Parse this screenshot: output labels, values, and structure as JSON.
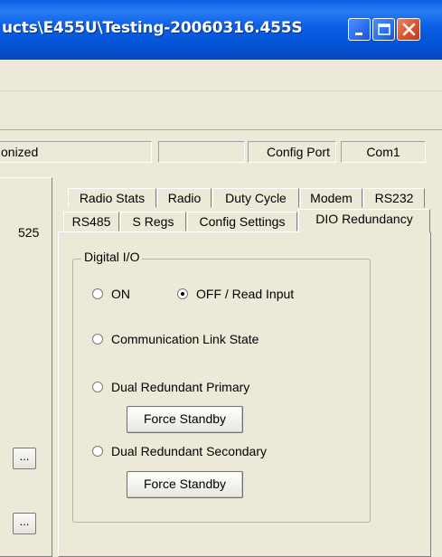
{
  "window": {
    "title": "ucts\\E455U\\Testing-20060316.455S"
  },
  "status_bar": {
    "fields": [
      "onized",
      "",
      "Config Port",
      "Com1"
    ]
  },
  "left_panel": {
    "text": "525",
    "buttons": [
      "...",
      "..."
    ]
  },
  "tabs": {
    "row1": [
      "Radio Stats",
      "Radio",
      "Duty Cycle",
      "Modem",
      "RS232"
    ],
    "row2": [
      "RS485",
      "S Regs",
      "Config Settings",
      "DIO Redundancy"
    ],
    "active": "DIO Redundancy"
  },
  "digital_io": {
    "group_title": "Digital I/O",
    "options": [
      {
        "label": "ON",
        "selected": false
      },
      {
        "label": "OFF / Read Input",
        "selected": true
      },
      {
        "label": "Communication Link State",
        "selected": false
      },
      {
        "label": "Dual Redundant Primary",
        "selected": false
      },
      {
        "label": "Dual Redundant Secondary",
        "selected": false
      }
    ],
    "primary_button": "Force Standby",
    "secondary_button": "Force Standby"
  },
  "icons": {
    "minimize": "minimize-icon",
    "maximize": "maximize-icon",
    "close": "close-icon"
  }
}
